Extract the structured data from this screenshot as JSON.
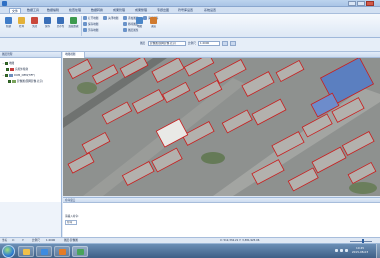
{
  "window": {
    "title": "",
    "controls": [
      "minimize",
      "maximize",
      "close"
    ]
  },
  "menubar": {
    "items": [
      {
        "label": "文件",
        "active": true
      },
      {
        "label": "数据工具"
      },
      {
        "label": "数据编辑"
      },
      {
        "label": "检查处理"
      },
      {
        "label": "数据转换"
      },
      {
        "label": "成果管理"
      },
      {
        "label": "成果整理"
      },
      {
        "label": "专题出图"
      },
      {
        "label": "符号库设置"
      },
      {
        "label": "系统设置"
      }
    ]
  },
  "ribbon": {
    "large_buttons": [
      {
        "label": "新建",
        "icon": "new-project-icon",
        "color": "#3f7cc8"
      },
      {
        "label": "打开",
        "icon": "open-folder-icon",
        "color": "#e3b13a"
      },
      {
        "label": "关闭",
        "icon": "close-doc-icon",
        "color": "#c9473b"
      },
      {
        "label": "保存",
        "icon": "save-icon",
        "color": "#3a6fb8"
      },
      {
        "label": "另存为",
        "icon": "save-as-icon",
        "color": "#3a6fb8"
      },
      {
        "label": "加载数据",
        "icon": "add-data-icon",
        "color": "#3d9a4f"
      }
    ],
    "group2_small": [
      {
        "label": "打开地图"
      },
      {
        "label": "保存地图"
      },
      {
        "label": "另存地图"
      },
      {
        "label": "关闭地图"
      }
    ],
    "group3_small": [
      {
        "label": "添加图层"
      },
      {
        "label": "移除图层"
      },
      {
        "label": "图层属性"
      },
      {
        "label": "清除缓存"
      }
    ],
    "map_big_button": {
      "label": "地图",
      "icon": "map-icon",
      "color": "#4a86c7"
    },
    "exit_button": {
      "label": "退出",
      "icon": "exit-icon",
      "color": "#d07a2e"
    },
    "combo_label": "图层",
    "combo_value": "影像图(国网影像·北京)",
    "scale_label": "比例尺",
    "scale_value": "1:2000"
  },
  "layers_panel": {
    "title": "图层管理",
    "rows": [
      {
        "label": "地图",
        "expander": "−",
        "checked": true,
        "level": 0
      },
      {
        "label": "房屋外轮廓",
        "expander": "",
        "checked": true,
        "level": 1
      },
      {
        "label": "DOM_DEM(TIFF)",
        "expander": "−",
        "checked": true,
        "level": 1
      },
      {
        "label": "影像图(国网影像·北京)",
        "expander": "",
        "checked": true,
        "level": 2
      }
    ]
  },
  "map_tab": {
    "label": "地图视图"
  },
  "command_panel": {
    "title": "命令窗口",
    "prompt": "请输入命令:",
    "input_value": "命令"
  },
  "statusbar": {
    "items": [
      "坐标",
      "X:",
      "Y:",
      "比例尺",
      "1:2000",
      "图层:影像图"
    ],
    "coords": "X: 512,334.21  Y: 3,381,925.06",
    "zoom_level_pct": 60
  },
  "taskbar": {
    "apps": [
      {
        "icon": "explorer-icon",
        "color": "#f0c04a"
      },
      {
        "icon": "browser-icon",
        "color": "#3d8be0"
      },
      {
        "icon": "media-icon",
        "color": "#e47b27"
      },
      {
        "icon": "gis-app-icon",
        "color": "#49a35a"
      }
    ],
    "time": "10:45",
    "date": "2015-08-03"
  }
}
